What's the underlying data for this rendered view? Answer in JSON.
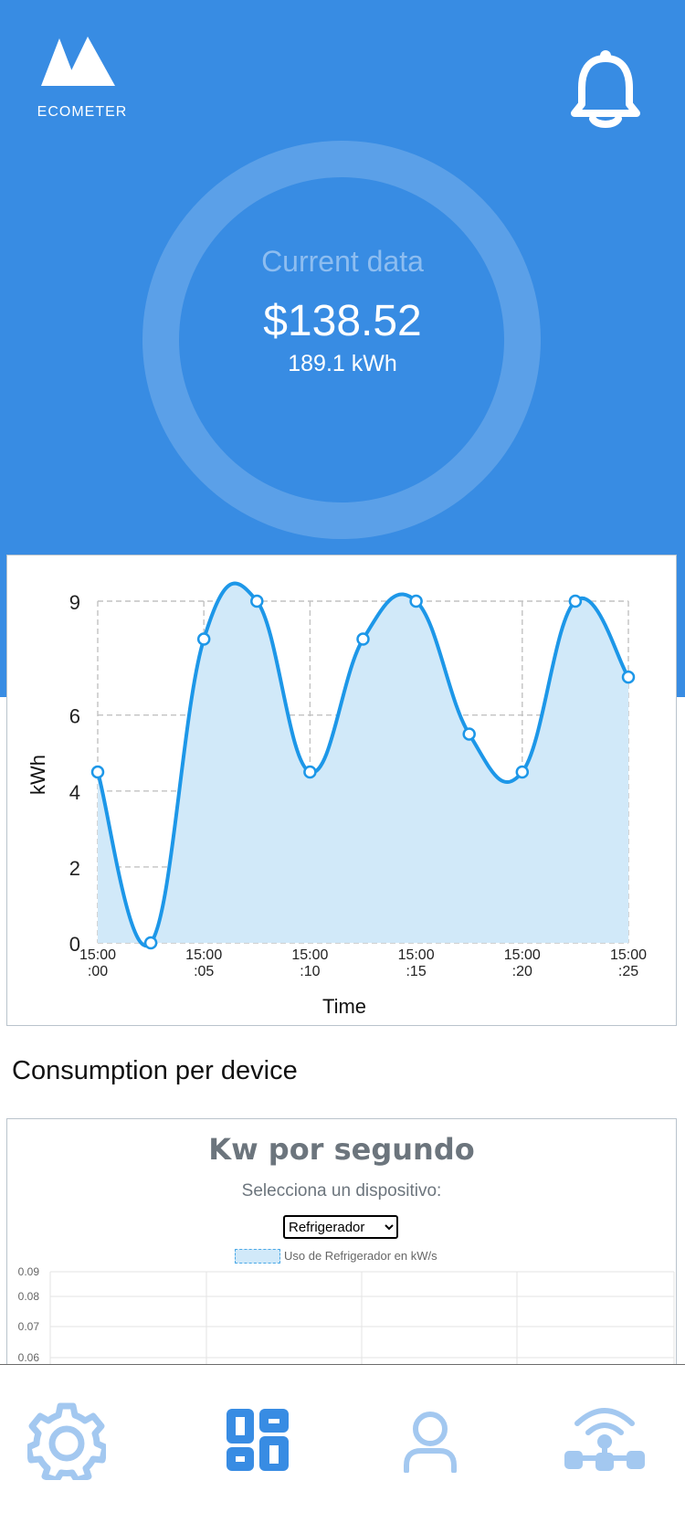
{
  "header": {
    "app_name": "ECOMETER",
    "bell_icon": "bell-icon"
  },
  "current": {
    "label": "Current data",
    "price": "$138.52",
    "energy": "189.1 kWh"
  },
  "colors": {
    "brand_blue": "#388ce3",
    "line_blue": "#1d97e8",
    "fill_blue": "#d1e9f9",
    "nav_light": "#a3c8f0",
    "nav_active": "#388ce3"
  },
  "chart_data": {
    "type": "area",
    "title": "",
    "xlabel": "Time",
    "ylabel": "kWh",
    "ylim": [
      0,
      9
    ],
    "yticks": [
      0,
      2,
      4,
      6,
      9
    ],
    "xticks": [
      "15:00:00",
      "15:00:05",
      "15:00:10",
      "15:00:15",
      "15:00:20",
      "15:00:25"
    ],
    "x": [
      0,
      2.5,
      5,
      7.5,
      10,
      12.5,
      15,
      17.5,
      20,
      22.5,
      25
    ],
    "values": [
      4.5,
      0,
      8,
      9,
      4.5,
      8,
      9,
      5.5,
      4.5,
      9,
      7
    ],
    "grid": true
  },
  "devices": {
    "section_title": "Consumption per device",
    "chart_title": "Kw por segundo",
    "select_label": "Selecciona un dispositivo:",
    "selected_device": "Refrigerador",
    "legend": "Uso de Refrigerador en kW/s",
    "yticks": [
      "0.09",
      "0.08",
      "0.07",
      "0.06"
    ]
  },
  "nav": {
    "items": [
      {
        "icon": "gear-icon",
        "label": "settings"
      },
      {
        "icon": "dashboard-icon",
        "label": "dashboard"
      },
      {
        "icon": "user-icon",
        "label": "profile"
      },
      {
        "icon": "wireless-network-icon",
        "label": "network"
      }
    ]
  }
}
